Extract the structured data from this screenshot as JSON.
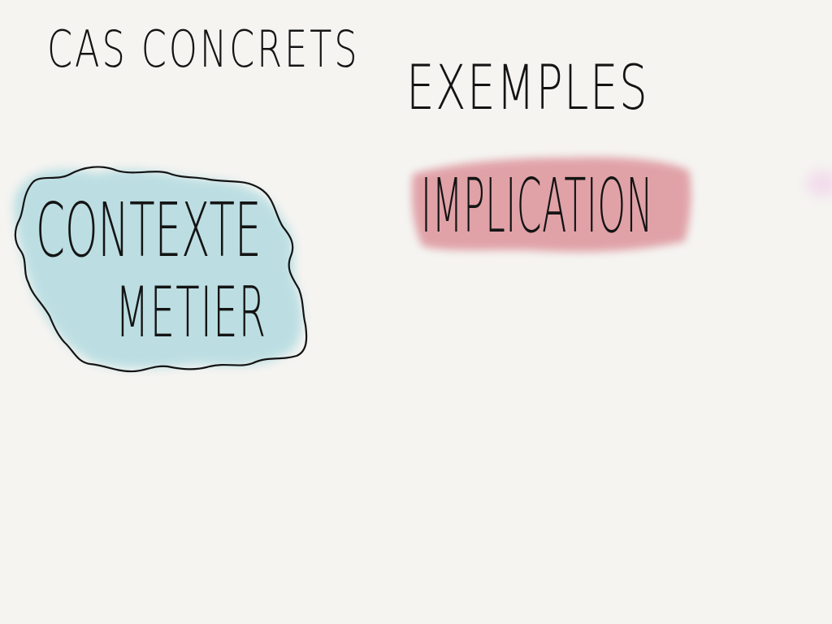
{
  "sketch": {
    "title_left": "CAS CONCRETS",
    "title_right": "EXEMPLES",
    "blue_note_line1": "CONTEXTE",
    "blue_note_line2": "METIER",
    "red_note": "IMPLICATION"
  },
  "colors": {
    "paper": "#f5f4f1",
    "ink": "#141414",
    "blue_wash": "#b9dde2",
    "red_wash": "#df9ea4",
    "pink_hint": "#f2d8ea"
  }
}
